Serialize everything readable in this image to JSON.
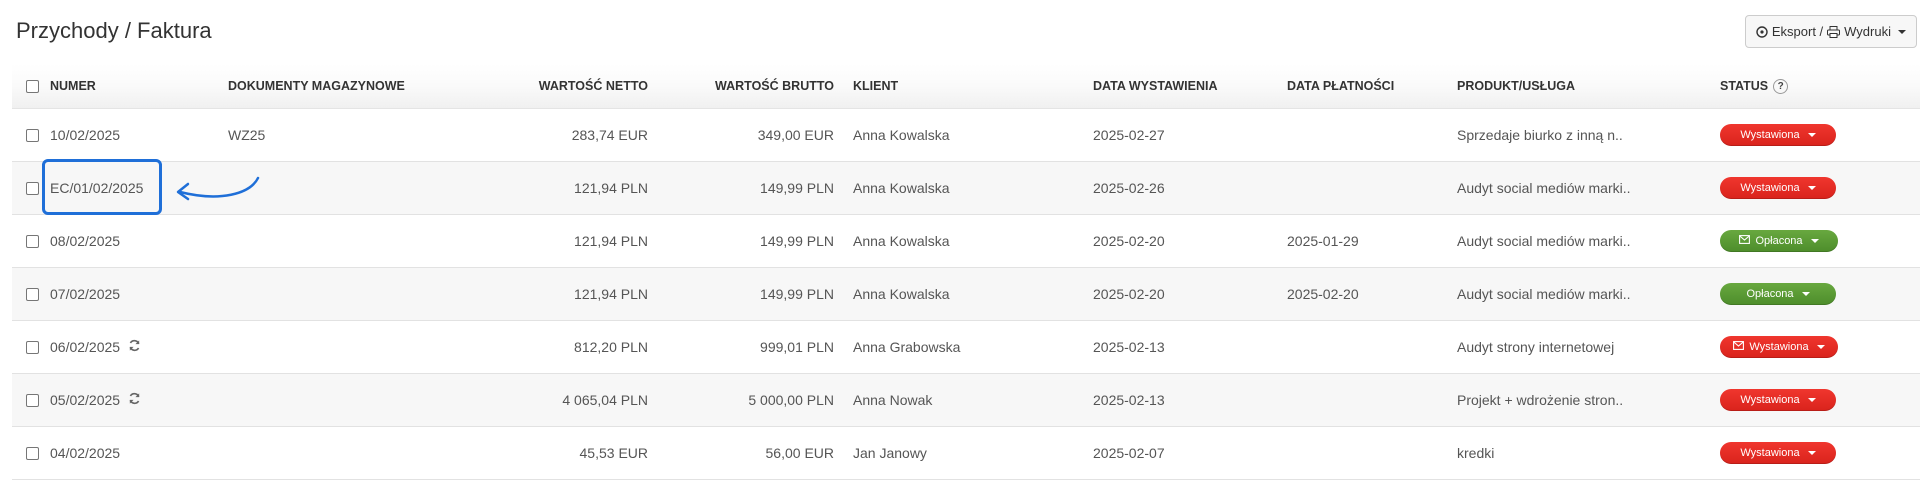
{
  "page": {
    "title": "Przychody / Faktura"
  },
  "toolbar": {
    "export_label": "Eksport / ",
    "print_label": "Wydruki"
  },
  "columns": {
    "numer": "NUMER",
    "dokumenty": "DOKUMENTY MAGAZYNOWE",
    "netto": "WARTOŚĆ NETTO",
    "brutto": "WARTOŚĆ BRUTTO",
    "klient": "KLIENT",
    "data_wystawienia": "DATA WYSTAWIENIA",
    "data_platnosci": "DATA PŁATNOŚCI",
    "produkt": "PRODUKT/USŁUGA",
    "status": "STATUS",
    "status_help": "?"
  },
  "rows": [
    {
      "numer": "10/02/2025",
      "dokumenty": "WZ25",
      "netto": "283,74 EUR",
      "brutto": "349,00 EUR",
      "klient": "Anna Kowalska",
      "data_wystawienia": "2025-02-27",
      "data_platnosci": "",
      "produkt": "Sprzedaje biurko z inną n..",
      "status": "Wystawiona",
      "status_color": "red",
      "mail": false,
      "recurring": false
    },
    {
      "numer": "EC/01/02/2025",
      "dokumenty": "",
      "netto": "121,94 PLN",
      "brutto": "149,99 PLN",
      "klient": "Anna Kowalska",
      "data_wystawienia": "2025-02-26",
      "data_platnosci": "",
      "produkt": "Audyt social mediów marki..",
      "status": "Wystawiona",
      "status_color": "red",
      "mail": false,
      "recurring": false
    },
    {
      "numer": "08/02/2025",
      "dokumenty": "",
      "netto": "121,94 PLN",
      "brutto": "149,99 PLN",
      "klient": "Anna Kowalska",
      "data_wystawienia": "2025-02-20",
      "data_platnosci": "2025-01-29",
      "produkt": "Audyt social mediów marki..",
      "status": "Opłacona",
      "status_color": "green",
      "mail": true,
      "recurring": false
    },
    {
      "numer": "07/02/2025",
      "dokumenty": "",
      "netto": "121,94 PLN",
      "brutto": "149,99 PLN",
      "klient": "Anna Kowalska",
      "data_wystawienia": "2025-02-20",
      "data_platnosci": "2025-02-20",
      "produkt": "Audyt social mediów marki..",
      "status": "Opłacona",
      "status_color": "green",
      "mail": false,
      "recurring": false
    },
    {
      "numer": "06/02/2025",
      "dokumenty": "",
      "netto": "812,20 PLN",
      "brutto": "999,01 PLN",
      "klient": "Anna Grabowska",
      "data_wystawienia": "2025-02-13",
      "data_platnosci": "",
      "produkt": "Audyt strony internetowej",
      "status": "Wystawiona",
      "status_color": "red",
      "mail": true,
      "recurring": true
    },
    {
      "numer": "05/02/2025",
      "dokumenty": "",
      "netto": "4 065,04 PLN",
      "brutto": "5 000,00 PLN",
      "klient": "Anna Nowak",
      "data_wystawienia": "2025-02-13",
      "data_platnosci": "",
      "produkt": "Projekt + wdrożenie stron..",
      "status": "Wystawiona",
      "status_color": "red",
      "mail": false,
      "recurring": true
    },
    {
      "numer": "04/02/2025",
      "dokumenty": "",
      "netto": "45,53 EUR",
      "brutto": "56,00 EUR",
      "klient": "Jan Janowy",
      "data_wystawienia": "2025-02-07",
      "data_platnosci": "",
      "produkt": "kredki",
      "status": "Wystawiona",
      "status_color": "red",
      "mail": false,
      "recurring": false
    }
  ],
  "colors": {
    "status_red": "#e52d25",
    "status_green": "#5a9b35",
    "annotation_blue": "#1f6fd8"
  }
}
